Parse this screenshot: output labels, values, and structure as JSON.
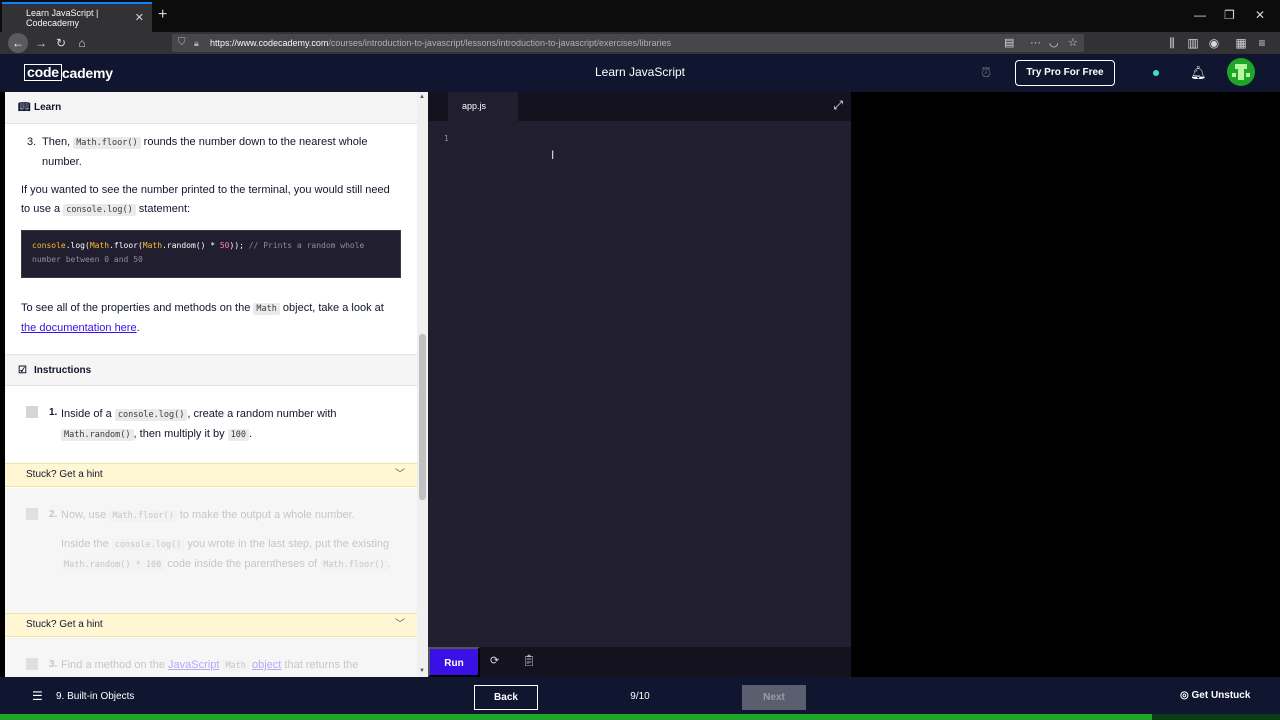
{
  "browser": {
    "tab_title": "Learn JavaScript | Codecademy",
    "url_host": "https://www.codecademy.com",
    "url_path": "/courses/introduction-to-javascript/lessons/introduction-to-javascript/exercises/libraries"
  },
  "header": {
    "logo_code": "code",
    "logo_cademy": "cademy",
    "title": "Learn JavaScript",
    "pro_button": "Try Pro For Free"
  },
  "lesson": {
    "learn_heading": "Learn",
    "step3_num": "3.",
    "step3_text_a": "Then, ",
    "step3_code": "Math.floor()",
    "step3_text_b": " rounds the number down to the nearest whole number.",
    "para1_a": "If you wanted to see the number printed to the terminal, you would still need to use a ",
    "para1_code": "console.log()",
    "para1_b": " statement:",
    "code_line1_a": "console",
    "code_line1_b": ".log(",
    "code_line1_c": "Math",
    "code_line1_d": ".floor(",
    "code_line1_e": "Math",
    "code_line1_f": ".random() * ",
    "code_line1_g": "50",
    "code_line1_h": ")); ",
    "code_comment": "// Prints a random whole number between 0 and 50",
    "para2_a": "To see all of the properties and methods on the ",
    "para2_code": "Math",
    "para2_b": " object, take a look at ",
    "para2_link": "the documentation here",
    "para2_c": ".",
    "instructions_heading": "Instructions",
    "task1_num": "1.",
    "task1_a": "Inside of a ",
    "task1_code1": "console.log()",
    "task1_b": ", create a random number with ",
    "task1_code2": "Math.random()",
    "task1_c": ", then multiply it by ",
    "task1_code3": "100",
    "task1_d": ".",
    "hint_label": "Stuck? Get a hint",
    "task2_num": "2.",
    "task2_a": "Now, use ",
    "task2_code1": "Math.floor()",
    "task2_b": " to make the output a whole number.",
    "task2_p2_a": "Inside the ",
    "task2_p2_code1": "console.log()",
    "task2_p2_b": " you wrote in the last step, put the existing ",
    "task2_p2_code2": "Math.random() * 100",
    "task2_p2_c": " code inside the parentheses of ",
    "task2_p2_code3": "Math.floor()",
    "task2_p2_d": ".",
    "task3_num": "3.",
    "task3_a": "Find a method on the ",
    "task3_link1": "JavaScript",
    "task3_code": "Math",
    "task3_link2": "object",
    "task3_b": " that returns the"
  },
  "editor": {
    "file_tab": "app.js",
    "line_number": "1",
    "run_label": "Run"
  },
  "footer": {
    "unit": "9. Built-in Objects",
    "back": "Back",
    "counter": "9/10",
    "next": "Next",
    "unstuck": "Get Unstuck",
    "progress": 0.9
  }
}
